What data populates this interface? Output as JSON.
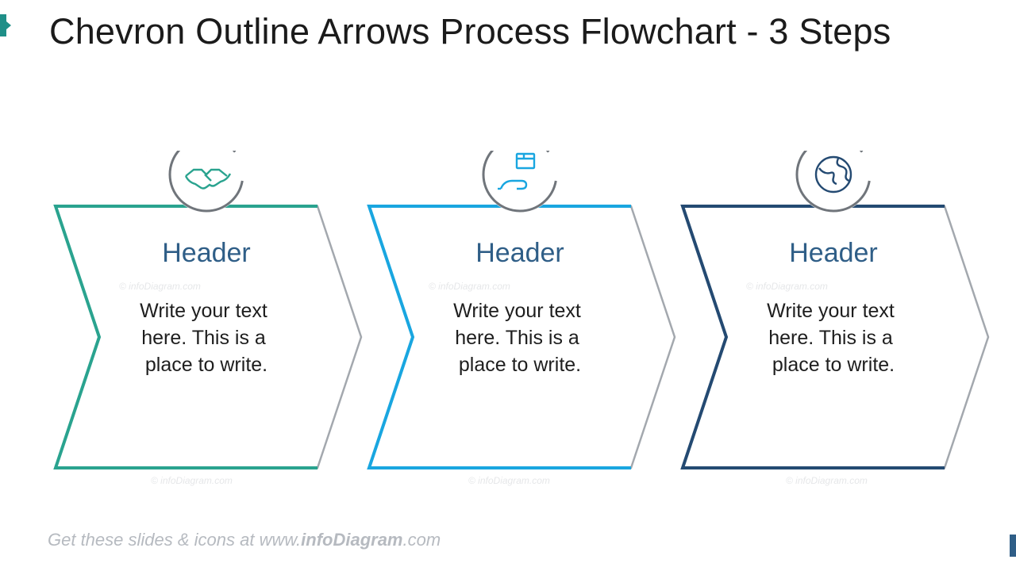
{
  "title": "Chevron Outline Arrows Process Flowchart - 3 Steps",
  "colors": {
    "step1": "#2aa38f",
    "step2": "#19a6e0",
    "step3": "#244a72"
  },
  "steps": [
    {
      "header": "Header",
      "body1": "Write your text",
      "body2": "here. This is a",
      "body3": "place to write.",
      "icon": "handshake-icon"
    },
    {
      "header": "Header",
      "body1": "Write your text",
      "body2": "here. This is a",
      "body3": "place to write.",
      "icon": "hand-box-icon"
    },
    {
      "header": "Header",
      "body1": "Write your text",
      "body2": "here. This is a",
      "body3": "place to write.",
      "icon": "globe-icon"
    }
  ],
  "footer_prefix": "Get these slides & icons at www.",
  "footer_brand": "infoDiagram",
  "footer_suffix": ".com",
  "watermark": "© infoDiagram.com"
}
